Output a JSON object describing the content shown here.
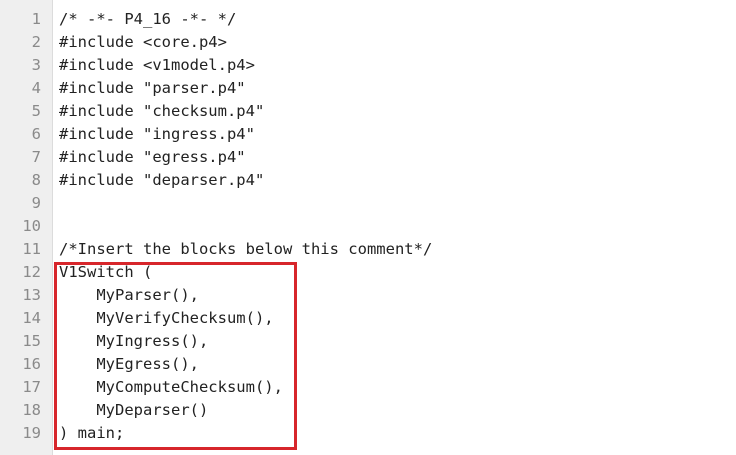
{
  "editor": {
    "highlight_color": "#d7262b",
    "lines": [
      {
        "num": "1",
        "text": "/* -*- P4_16 -*- */"
      },
      {
        "num": "2",
        "text": "#include <core.p4>"
      },
      {
        "num": "3",
        "text": "#include <v1model.p4>"
      },
      {
        "num": "4",
        "text": "#include \"parser.p4\""
      },
      {
        "num": "5",
        "text": "#include \"checksum.p4\""
      },
      {
        "num": "6",
        "text": "#include \"ingress.p4\""
      },
      {
        "num": "7",
        "text": "#include \"egress.p4\""
      },
      {
        "num": "8",
        "text": "#include \"deparser.p4\""
      },
      {
        "num": "9",
        "text": ""
      },
      {
        "num": "10",
        "text": ""
      },
      {
        "num": "11",
        "text": "/*Insert the blocks below this comment*/"
      },
      {
        "num": "12",
        "text": "V1Switch ("
      },
      {
        "num": "13",
        "text": "    MyParser(),"
      },
      {
        "num": "14",
        "text": "    MyVerifyChecksum(),"
      },
      {
        "num": "15",
        "text": "    MyIngress(),"
      },
      {
        "num": "16",
        "text": "    MyEgress(),"
      },
      {
        "num": "17",
        "text": "    MyComputeChecksum(),"
      },
      {
        "num": "18",
        "text": "    MyDeparser()"
      },
      {
        "num": "19",
        "text": ") main;"
      }
    ]
  }
}
